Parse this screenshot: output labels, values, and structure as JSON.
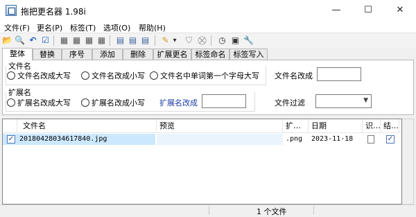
{
  "window": {
    "title": "拖把更名器 1.98i",
    "minimize": "—",
    "maximize": "☐",
    "close": "✕"
  },
  "menu": [
    "文件(F)",
    "更名(P)",
    "标签(T)",
    "选项(O)",
    "帮助(H)"
  ],
  "toolbar": {
    "icons": [
      "open-folder-icon",
      "search-icon",
      "undo-icon",
      "check-icon",
      "rename-grid-icon",
      "rename-grid-icon",
      "rename-grid-icon",
      "rename-grid-icon",
      "document-icon",
      "document-icon",
      "document-icon",
      "pencil-icon",
      "tag-icon",
      "clear-tag-icon",
      "clock-icon",
      "preview-icon",
      "wrench-icon"
    ],
    "glyphs": [
      "📂",
      "🔍",
      "↶",
      "☑",
      "▦",
      "▦",
      "▦",
      "▦",
      "▤",
      "▤",
      "▤",
      "✎",
      "⛉",
      "⛒",
      "◷",
      "▣",
      "🔧"
    ],
    "dropdown_glyph": "▾"
  },
  "tabs": [
    "整体",
    "替换",
    "序号",
    "添加",
    "删除",
    "扩展更名",
    "标签命名",
    "标签写入"
  ],
  "active_tab": "整体",
  "filename_group": {
    "title": "文件名",
    "opt_upper": "文件名改成大写",
    "opt_lower": "文件名改成小写",
    "opt_capitalize": "文件名中单词第一个字母大写",
    "change_label": "文件名改成",
    "change_value": ""
  },
  "extension_group": {
    "title": "扩展名",
    "opt_upper": "扩展名改成大写",
    "opt_lower": "扩展名改成小写",
    "change_label": "扩展名改成",
    "change_value": ""
  },
  "filter": {
    "label": "文件过滤",
    "value": ""
  },
  "list": {
    "headers": {
      "filename": "文件名",
      "preview": "预览",
      "ext": "扩…",
      "date": "日期",
      "id": "识…",
      "result": "结…"
    },
    "rows": [
      {
        "checked": "✓",
        "filename": "20180428034617840.jpg",
        "preview": "",
        "ext": ".png",
        "date": "2023-11-18",
        "result_check": "✓"
      }
    ]
  },
  "status": {
    "file_count": "1 个文件"
  },
  "colors": {
    "accent_blue": "#1a3aa8",
    "selected_row": "#cce8ff"
  }
}
